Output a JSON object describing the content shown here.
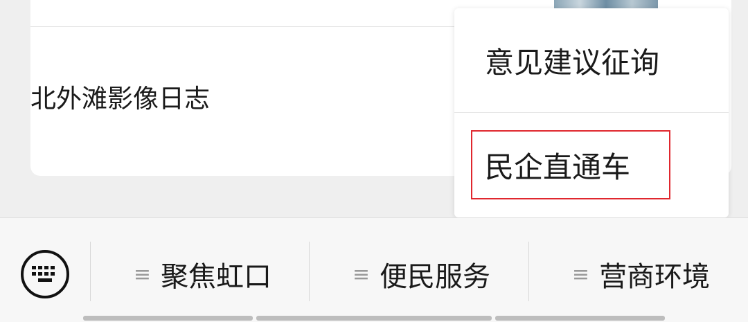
{
  "article": {
    "title": "北外滩影像日志"
  },
  "popup_menu": {
    "items": [
      {
        "label": "意见建议征询"
      },
      {
        "label": "民企直通车"
      }
    ]
  },
  "bottom_tabs": [
    {
      "label": "聚焦虹口"
    },
    {
      "label": "便民服务"
    },
    {
      "label": "营商环境"
    }
  ],
  "colors": {
    "highlight_border": "#e0272e",
    "background": "#efefef"
  },
  "icons": {
    "keyboard": "keyboard-icon",
    "menu": "hamburger-icon"
  }
}
